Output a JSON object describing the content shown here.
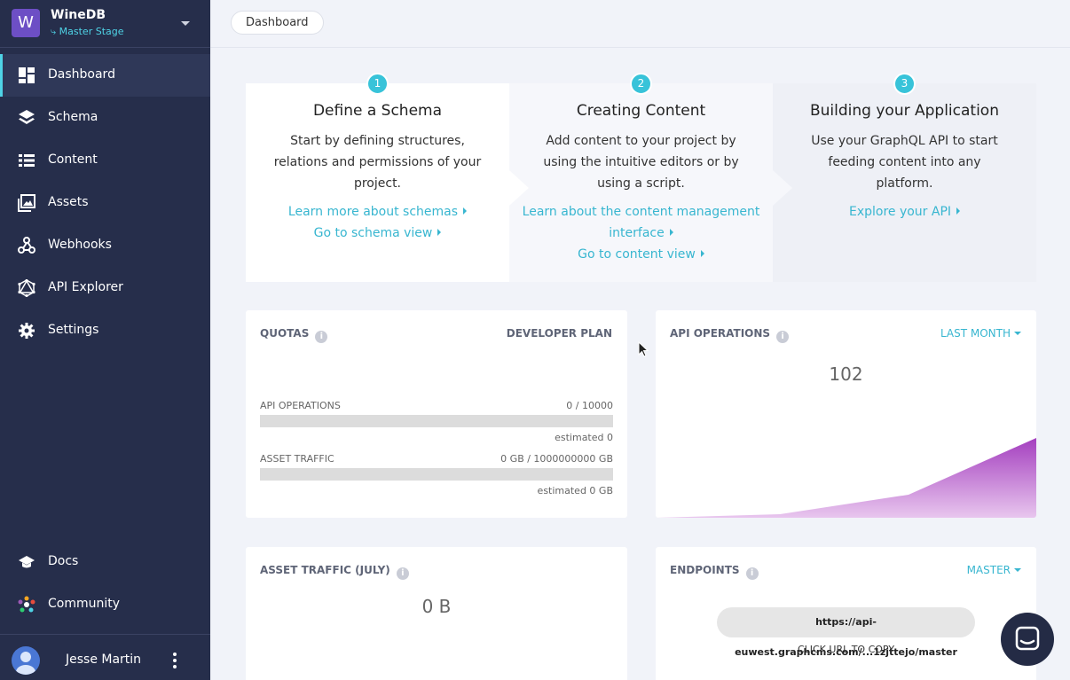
{
  "project": {
    "logo_letter": "W",
    "name": "WineDB",
    "stage": "⤷ Master Stage"
  },
  "nav": {
    "items": [
      {
        "label": "Dashboard",
        "icon": "dashboard-icon"
      },
      {
        "label": "Schema",
        "icon": "layers-icon"
      },
      {
        "label": "Content",
        "icon": "list-icon"
      },
      {
        "label": "Assets",
        "icon": "image-icon"
      },
      {
        "label": "Webhooks",
        "icon": "webhook-icon"
      },
      {
        "label": "API Explorer",
        "icon": "graphql-icon"
      },
      {
        "label": "Settings",
        "icon": "gear-icon"
      }
    ],
    "bottom": [
      {
        "label": "Docs",
        "icon": "graduation-cap-icon"
      },
      {
        "label": "Community",
        "icon": "community-icon"
      }
    ]
  },
  "user": {
    "name": "Jesse Martin"
  },
  "breadcrumb": "Dashboard",
  "steps": [
    {
      "num": "1",
      "title": "Define a Schema",
      "text": "Start by defining structures, relations and permissions of your project.",
      "links": [
        "Learn more about schemas",
        "Go to schema view"
      ]
    },
    {
      "num": "2",
      "title": "Creating Content",
      "text": "Add content to your project by using the intuitive editors or by using a script.",
      "links": [
        "Learn about the content management interface",
        "Go to content view"
      ]
    },
    {
      "num": "3",
      "title": "Building your Application",
      "text": "Use your GraphQL API to start feeding content into any platform.",
      "links": [
        "Explore your API"
      ]
    }
  ],
  "quotas": {
    "title": "QUOTAS",
    "plan": "DEVELOPER PLAN",
    "rows": [
      {
        "label": "API OPERATIONS",
        "value": "0 / 10000",
        "estimate": "estimated 0",
        "fraction": 0
      },
      {
        "label": "ASSET TRAFFIC",
        "value": "0 GB / 1000000000 GB",
        "estimate": "estimated 0 GB",
        "fraction": 0
      }
    ]
  },
  "api_ops": {
    "title": "API OPERATIONS",
    "period": "LAST MONTH",
    "count": "102"
  },
  "asset_traffic": {
    "title": "ASSET TRAFFIC (JULY)",
    "value": "0 B"
  },
  "endpoints": {
    "title": "ENDPOINTS",
    "stage": "MASTER",
    "url": "https://api-euwest.graphcms.com/...1zjttejo/master",
    "hint": "CLICK URL TO COPY"
  },
  "colors": {
    "sidebar": "#262e4b",
    "accent": "#38b6d0",
    "chart": "#a43fbf",
    "logo": "#6d4fc5"
  }
}
